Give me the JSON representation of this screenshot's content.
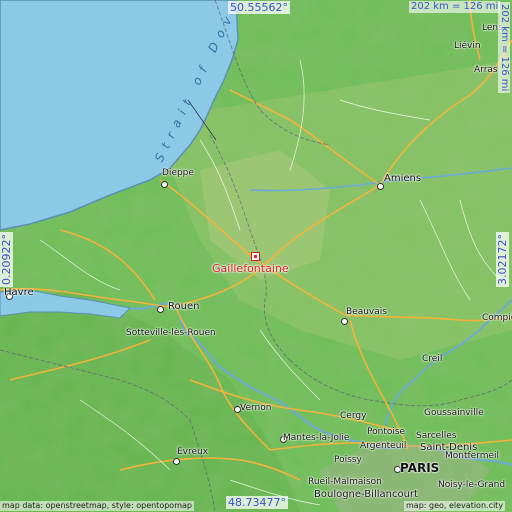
{
  "map": {
    "target_city": "Gaillefontaine",
    "colors": {
      "sea": "#8cc9e6",
      "coast": "#5a8fb4",
      "lowland": "#6dbd57",
      "upland": "#a9c878",
      "road": "#f4b23a",
      "border": "#5c5c7a",
      "river": "#6aa9d8",
      "target": "#dd2222"
    },
    "sea_name": "Strait of Dover",
    "coords": {
      "top": "50.55562°",
      "bottom": "48.73477°",
      "left": "0.20922°",
      "right": "3.02172°"
    },
    "scale": {
      "horizontal": "202 km = 126 mi",
      "vertical": "202 km = 126 mi"
    },
    "attribution_left": "map data: openstreetmap, style: opentopomap",
    "attribution_right": "map: geo, elevation.city",
    "places": [
      {
        "id": "dieppe",
        "name": "Dieppe"
      },
      {
        "id": "amiens",
        "name": "Amiens"
      },
      {
        "id": "lievin",
        "name": "Liévin"
      },
      {
        "id": "arras",
        "name": "Arras"
      },
      {
        "id": "lens",
        "name": "Lens"
      },
      {
        "id": "lehavre",
        "name": "Havre"
      },
      {
        "id": "rouen",
        "name": "Rouen"
      },
      {
        "id": "sotteville",
        "name": "Sotteville-lès-Rouen"
      },
      {
        "id": "beauvais",
        "name": "Beauvais"
      },
      {
        "id": "compiegne",
        "name": "Compiè"
      },
      {
        "id": "creil",
        "name": "Creil"
      },
      {
        "id": "vernon",
        "name": "Vernon"
      },
      {
        "id": "evreux",
        "name": "Évreux"
      },
      {
        "id": "cergy",
        "name": "Cergy"
      },
      {
        "id": "pontoise",
        "name": "Pontoise"
      },
      {
        "id": "goussainville",
        "name": "Goussainville"
      },
      {
        "id": "sarcelles",
        "name": "Sarcelles"
      },
      {
        "id": "mantes",
        "name": "Mantes-la-Jolie"
      },
      {
        "id": "argenteuil",
        "name": "Argenteuil"
      },
      {
        "id": "saintdenis",
        "name": "Saint-Denis"
      },
      {
        "id": "montfermeil",
        "name": "Montfermeil"
      },
      {
        "id": "poissy",
        "name": "Poissy"
      },
      {
        "id": "paris",
        "name": "PARIS"
      },
      {
        "id": "rueil",
        "name": "Rueil-Malmaison"
      },
      {
        "id": "boulogne",
        "name": "Boulogne-Billancourt"
      },
      {
        "id": "noisy",
        "name": "Noisy-le-Grand"
      }
    ]
  }
}
